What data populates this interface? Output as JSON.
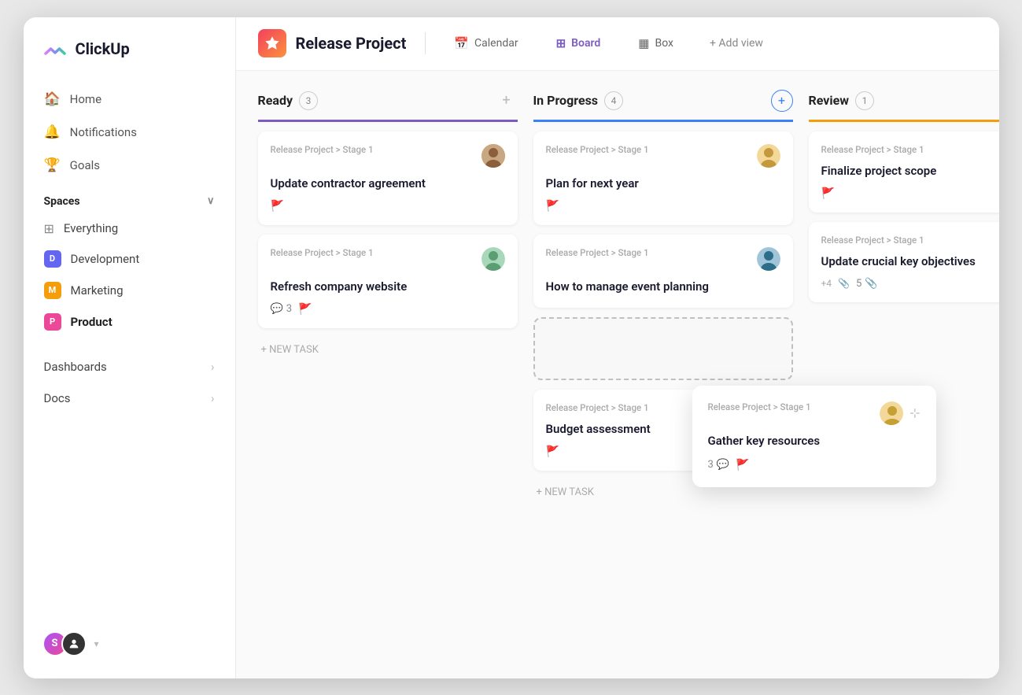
{
  "app": {
    "name": "ClickUp"
  },
  "sidebar": {
    "nav_items": [
      {
        "id": "home",
        "label": "Home",
        "icon": "🏠"
      },
      {
        "id": "notifications",
        "label": "Notifications",
        "icon": "🔔"
      },
      {
        "id": "goals",
        "label": "Goals",
        "icon": "🏆"
      }
    ],
    "spaces_label": "Spaces",
    "spaces": [
      {
        "id": "everything",
        "label": "Everything",
        "badge_color": null,
        "badge_letter": null
      },
      {
        "id": "development",
        "label": "Development",
        "badge_color": "#6366f1",
        "badge_letter": "D"
      },
      {
        "id": "marketing",
        "label": "Marketing",
        "badge_color": "#f59e0b",
        "badge_letter": "M"
      },
      {
        "id": "product",
        "label": "Product",
        "badge_color": "#ec4899",
        "badge_letter": "P",
        "active": true
      }
    ],
    "links": [
      {
        "id": "dashboards",
        "label": "Dashboards"
      },
      {
        "id": "docs",
        "label": "Docs"
      }
    ]
  },
  "header": {
    "project_name": "Release Project",
    "views": [
      {
        "id": "calendar",
        "label": "Calendar",
        "icon": "📅",
        "active": false
      },
      {
        "id": "board",
        "label": "Board",
        "icon": "⊞",
        "active": true
      },
      {
        "id": "box",
        "label": "Box",
        "icon": "▦",
        "active": false
      }
    ],
    "add_view_label": "+ Add view"
  },
  "board": {
    "columns": [
      {
        "id": "ready",
        "title": "Ready",
        "count": 3,
        "color": "#7c5cbf",
        "add_icon": "+",
        "tasks": [
          {
            "id": "t1",
            "meta": "Release Project > Stage 1",
            "title": "Update contractor agreement",
            "flag": "orange",
            "avatar_color": "#f4a261",
            "avatar_label": "U1"
          },
          {
            "id": "t2",
            "meta": "Release Project > Stage 1",
            "title": "Refresh company website",
            "flag": "green",
            "comments": 3,
            "avatar_color": "#81b29a",
            "avatar_label": "U2"
          }
        ],
        "new_task_label": "+ NEW TASK"
      },
      {
        "id": "in-progress",
        "title": "In Progress",
        "count": 4,
        "color": "#3b82f6",
        "add_icon": "+",
        "tasks": [
          {
            "id": "t3",
            "meta": "Release Project > Stage 1",
            "title": "Plan for next year",
            "flag": "red",
            "avatar_color": "#e9c46a",
            "avatar_label": "U3"
          },
          {
            "id": "t4",
            "meta": "Release Project > Stage 1",
            "title": "How to manage event planning",
            "flag": null,
            "avatar_color": "#264653",
            "avatar_label": "U4"
          },
          {
            "id": "t5-drag",
            "meta": "",
            "title": "",
            "dragging": true
          },
          {
            "id": "t6",
            "meta": "Release Project > Stage 1",
            "title": "Budget assessment",
            "flag": "orange",
            "avatar_color": null
          }
        ],
        "new_task_label": "+ NEW TASK"
      },
      {
        "id": "review",
        "title": "Review",
        "count": 1,
        "color": "#f59e0b",
        "add_icon": "+",
        "tasks": [
          {
            "id": "t7",
            "meta": "Release Project > Stage 1",
            "title": "Finalize project scope",
            "flag": "red",
            "avatar_color": null
          },
          {
            "id": "t8",
            "meta": "Release Project > Stage 1",
            "title": "Update crucial key objectives",
            "flag": null,
            "plus_more": "+4",
            "comments": 5,
            "has_attach": true
          }
        ]
      }
    ]
  },
  "floating_card": {
    "meta": "Release Project > Stage 1",
    "title": "Gather key resources",
    "comments": 3,
    "flag": "green",
    "avatar_color": "#e9c46a"
  }
}
